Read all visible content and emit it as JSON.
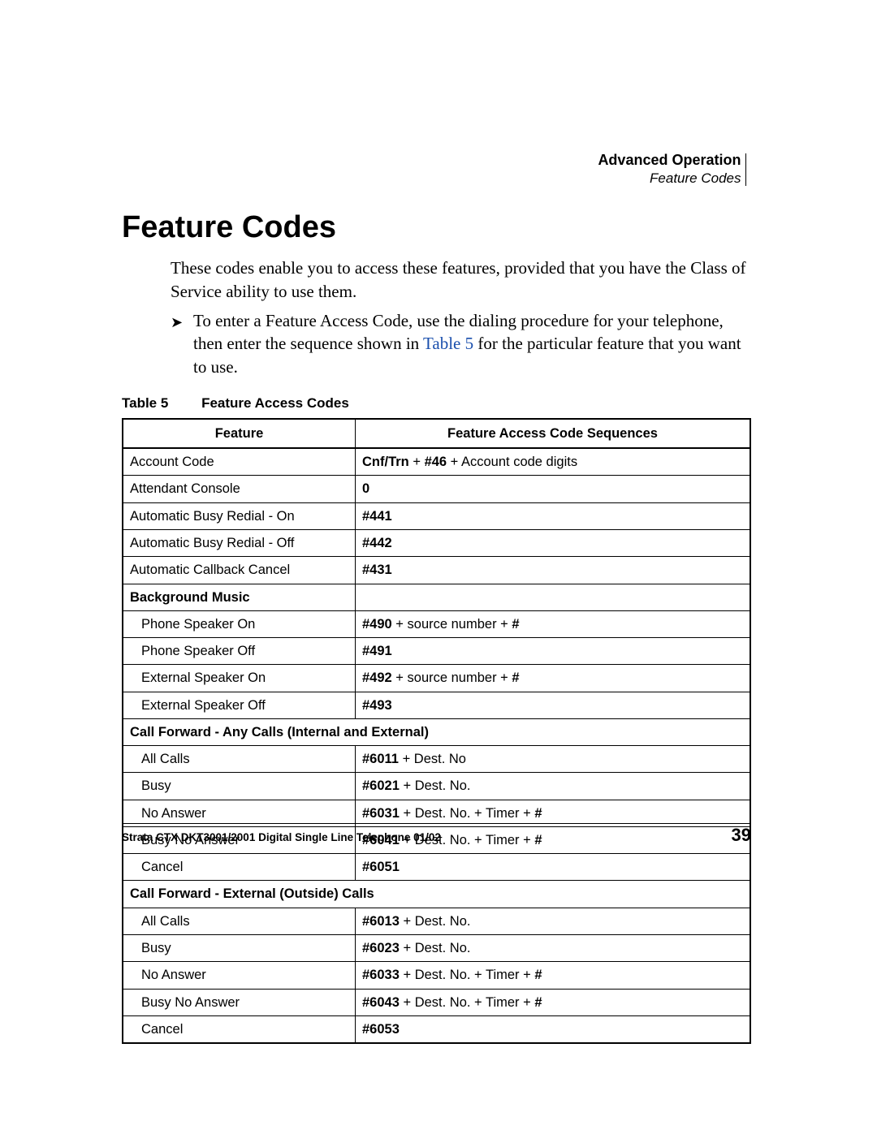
{
  "header": {
    "section": "Advanced Operation",
    "subsection": "Feature Codes"
  },
  "title": "Feature Codes",
  "intro": "These codes enable you to access these features, provided that you have the Class of Service ability to use them.",
  "step": {
    "pre": "To enter a Feature Access Code, use the dialing procedure for your telephone, then enter the sequence shown in ",
    "link": "Table 5",
    "post": " for the particular feature that you want to use."
  },
  "table": {
    "caption_label": "Table 5",
    "caption_title": "Feature Access Codes",
    "headers": {
      "feature": "Feature",
      "sequence": "Feature Access Code Sequences"
    },
    "rows": [
      {
        "type": "row",
        "feature": "Account Code",
        "seq": [
          {
            "b": "Cnf/Trn"
          },
          {
            "t": " + "
          },
          {
            "b": "#46"
          },
          {
            "t": " + Account code digits"
          }
        ]
      },
      {
        "type": "row",
        "feature": "Attendant Console",
        "seq": [
          {
            "b": "0"
          }
        ]
      },
      {
        "type": "row",
        "feature": "Automatic Busy Redial - On",
        "seq": [
          {
            "b": "#441"
          }
        ]
      },
      {
        "type": "row",
        "feature": "Automatic Busy Redial - Off",
        "seq": [
          {
            "b": "#442"
          }
        ]
      },
      {
        "type": "row",
        "feature": "Automatic Callback Cancel",
        "seq": [
          {
            "b": "#431"
          }
        ]
      },
      {
        "type": "section",
        "feature": "Background Music",
        "span": false
      },
      {
        "type": "sub",
        "feature": "Phone Speaker On",
        "seq": [
          {
            "b": "#490"
          },
          {
            "t": " + source number + "
          },
          {
            "b": "#"
          }
        ]
      },
      {
        "type": "sub",
        "feature": "Phone Speaker Off",
        "seq": [
          {
            "b": "#491"
          }
        ]
      },
      {
        "type": "sub",
        "feature": "External Speaker On",
        "seq": [
          {
            "b": "#492"
          },
          {
            "t": " + source number + "
          },
          {
            "b": "#"
          }
        ]
      },
      {
        "type": "sub",
        "feature": "External Speaker Off",
        "seq": [
          {
            "b": "#493"
          }
        ]
      },
      {
        "type": "section",
        "feature": "Call Forward - Any Calls (Internal and External)",
        "span": true
      },
      {
        "type": "sub",
        "feature": "All Calls",
        "seq": [
          {
            "b": "#6011"
          },
          {
            "t": " + Dest. No"
          }
        ]
      },
      {
        "type": "sub",
        "feature": "Busy",
        "seq": [
          {
            "b": "#6021"
          },
          {
            "t": " + Dest. No."
          }
        ]
      },
      {
        "type": "sub",
        "feature": "No Answer",
        "seq": [
          {
            "b": "#6031"
          },
          {
            "t": " + Dest. No. + Timer + "
          },
          {
            "b": "#"
          }
        ]
      },
      {
        "type": "sub",
        "feature": "Busy No Answer",
        "seq": [
          {
            "b": "#6041"
          },
          {
            "t": " + Dest. No. + Timer + "
          },
          {
            "b": "#"
          }
        ]
      },
      {
        "type": "sub",
        "feature": "Cancel",
        "seq": [
          {
            "b": "#6051"
          }
        ]
      },
      {
        "type": "section",
        "feature": "Call Forward - External (Outside) Calls",
        "span": true
      },
      {
        "type": "sub",
        "feature": "All Calls",
        "seq": [
          {
            "b": "#6013"
          },
          {
            "t": " + Dest. No."
          }
        ]
      },
      {
        "type": "sub",
        "feature": "Busy",
        "seq": [
          {
            "b": "#6023"
          },
          {
            "t": " + Dest. No."
          }
        ]
      },
      {
        "type": "sub",
        "feature": "No Answer",
        "seq": [
          {
            "b": "#6033"
          },
          {
            "t": " + Dest. No. + Timer + "
          },
          {
            "b": "#"
          }
        ]
      },
      {
        "type": "sub",
        "feature": "Busy No Answer",
        "seq": [
          {
            "b": "#6043"
          },
          {
            "t": " + Dest. No. + Timer + "
          },
          {
            "b": "#"
          }
        ]
      },
      {
        "type": "sub",
        "feature": "Cancel",
        "seq": [
          {
            "b": "#6053"
          }
        ]
      }
    ]
  },
  "footer": {
    "source": "Strata CTX DKT3001/2001 Digital Single Line Telephone   01/02",
    "page": "39"
  }
}
